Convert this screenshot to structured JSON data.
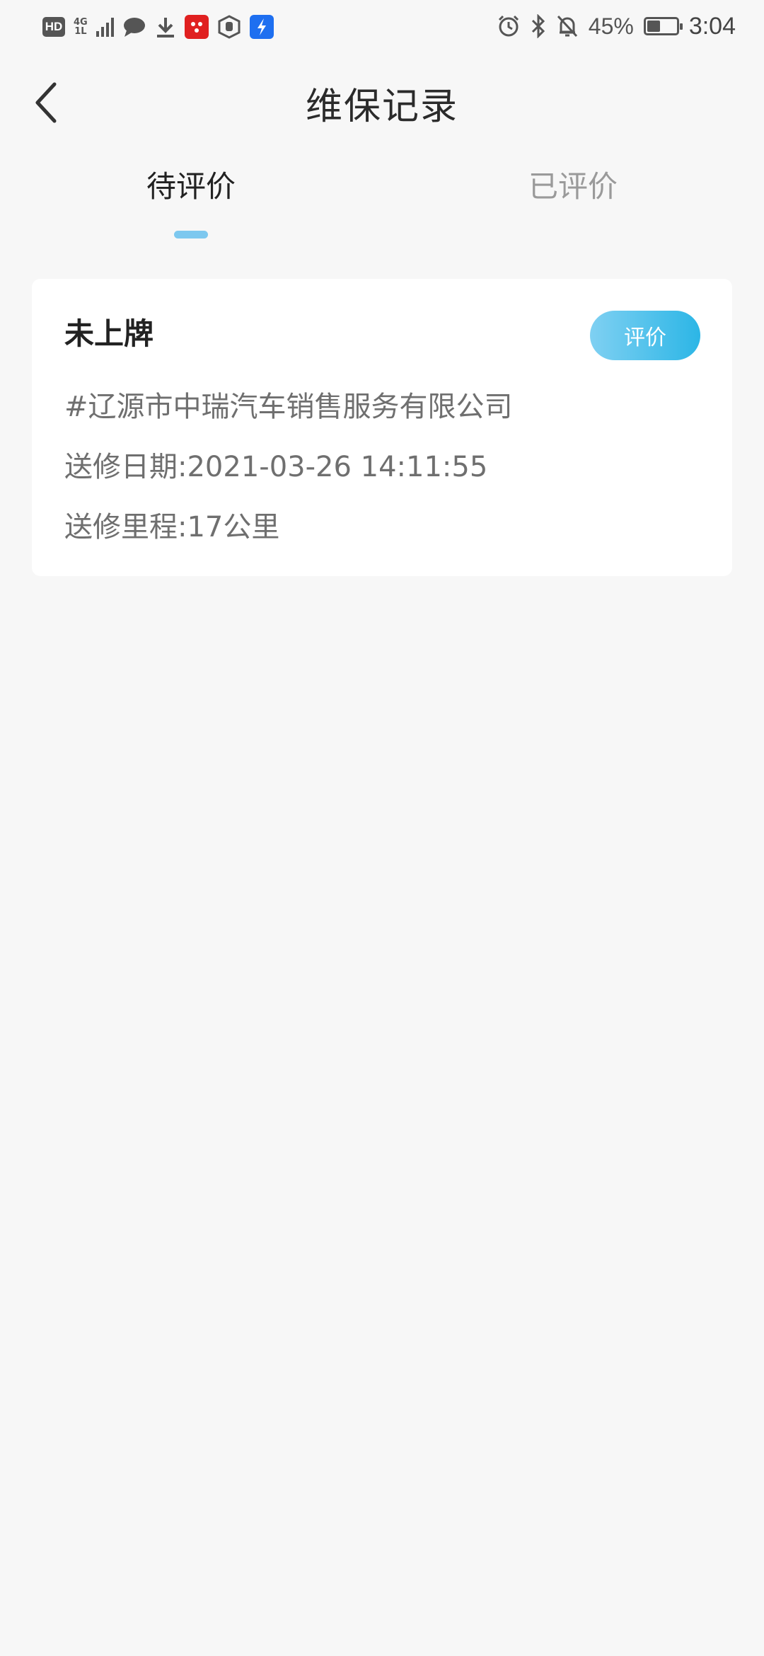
{
  "status_bar": {
    "left_icons": [
      "hd-icon",
      "4g-network-icon",
      "signal-strength-icon",
      "message-bubble-icon",
      "download-icon",
      "red-app-icon",
      "hand-app-icon",
      "blue-app-icon"
    ],
    "hd_label": "HD",
    "network_label_top": "4G",
    "network_label_bottom": "1L",
    "right_icons": [
      "alarm-icon",
      "bluetooth-icon",
      "mute-bell-icon"
    ],
    "battery_percent": "45%",
    "battery_level": 0.45,
    "time": "3:04"
  },
  "header": {
    "title": "维保记录",
    "back_icon": "chevron-left-icon"
  },
  "tabs": [
    {
      "label": "待评价",
      "active": true
    },
    {
      "label": "已评价",
      "active": false
    }
  ],
  "colors": {
    "accent": "#7dc8ef",
    "button_gradient_start": "#7fd0f2",
    "button_gradient_end": "#2cb6e6",
    "background": "#f7f7f7"
  },
  "records": [
    {
      "plate": "未上牌",
      "action_label": "评价",
      "company": "#辽源市中瑞汽车销售服务有限公司",
      "date_line": "送修日期:2021-03-26 14:11:55",
      "mileage_line": "送修里程:17公里"
    }
  ]
}
